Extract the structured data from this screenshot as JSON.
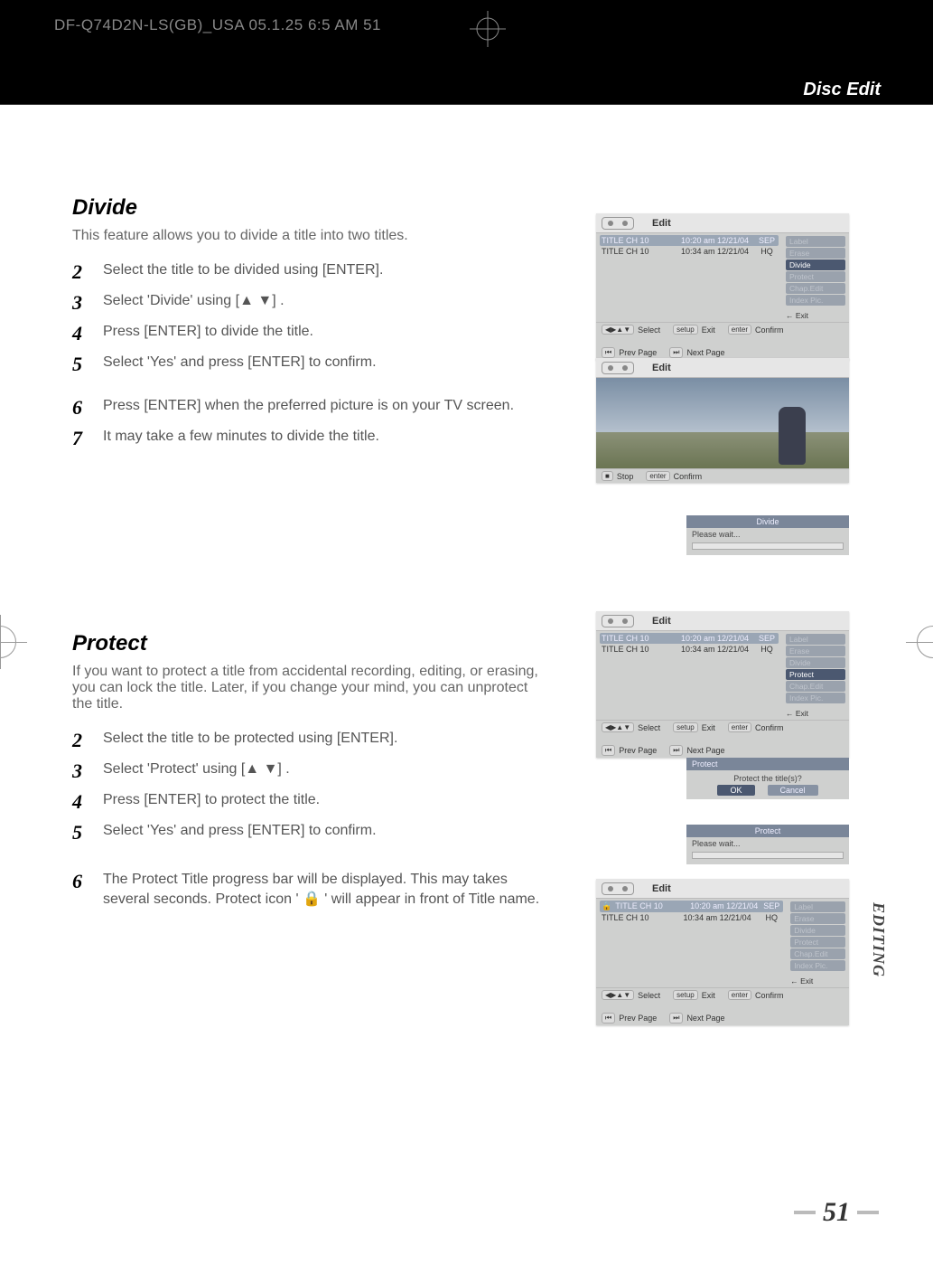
{
  "header": {
    "doc_info": "DF-Q74D2N-LS(GB)_USA  05.1.25 6:5 AM      51",
    "tab_label": "Disc Edit"
  },
  "section1": {
    "title": "Divide",
    "intro": "This feature allows you to divide a title into two titles.",
    "steps": [
      {
        "n": "2",
        "t": "Select the title to be divided using [ENTER]."
      },
      {
        "n": "3",
        "t": "Select 'Divide' using [▲ ▼] ."
      },
      {
        "n": "4",
        "t": "Press [ENTER] to divide the title."
      },
      {
        "n": "5",
        "t": "Select 'Yes'  and press [ENTER] to confirm."
      },
      {
        "n": "6",
        "t": "Press [ENTER] when the preferred picture is on your TV screen."
      },
      {
        "n": "7",
        "t": "It may take a few minutes to divide the title."
      }
    ]
  },
  "section2": {
    "title": "Protect",
    "intro": "If you want to protect a title from accidental recording, editing, or erasing, you can lock the title. Later, if you change your mind, you can unprotect the title.",
    "steps": [
      {
        "n": "2",
        "t": "Select the title to be protected using [ENTER]."
      },
      {
        "n": "3",
        "t": "Select 'Protect' using [▲ ▼] ."
      },
      {
        "n": "4",
        "t": "Press [ENTER] to protect the title."
      },
      {
        "n": "5",
        "t": "Select 'Yes'  and press [ENTER] to confirm."
      },
      {
        "n": "6",
        "t": "The Protect Title progress bar will be displayed. This may takes several seconds. Protect icon ' 🔒 ' will appear in front of Title name."
      }
    ]
  },
  "osd_common": {
    "edit_label": "Edit",
    "titles": [
      {
        "title": "TITLE CH 10",
        "date": "10:20 am 12/21/04",
        "qual": "SEP"
      },
      {
        "title": "TITLE CH 10",
        "date": "10:34 am 12/21/04",
        "qual": "HQ"
      }
    ],
    "menu": {
      "label": "Label",
      "erase": "Erase",
      "divide": "Divide",
      "protect": "Protect",
      "chap_edit": "Chap.Edit",
      "index_pic": "Index Pic.",
      "exit": "Exit"
    },
    "footer": {
      "select": "Select",
      "exit": "Exit",
      "confirm": "Confirm",
      "prev": "Prev Page",
      "next": "Next Page",
      "setup": "setup",
      "enter": "enter",
      "nav": "◀▶▲▼",
      "rw": "⏮",
      "ff": "⏭",
      "stop": "Stop",
      "stopsym": "■"
    }
  },
  "progress_divide": {
    "title": "Divide",
    "text": "Please wait..."
  },
  "progress_protect": {
    "title": "Protect",
    "text": "Please wait..."
  },
  "confirm_protect": {
    "title": "Protect",
    "question": "Protect the title(s)?",
    "ok": "OK",
    "cancel": "Cancel"
  },
  "side_tab": "EDITING",
  "page_number": "51"
}
